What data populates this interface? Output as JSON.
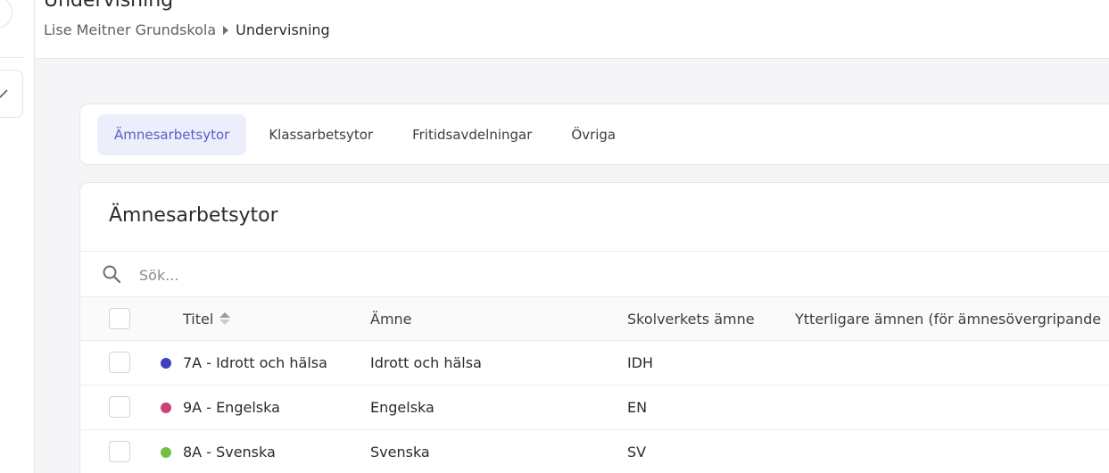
{
  "header": {
    "title": "Undervisning",
    "breadcrumb": {
      "parent": "Lise Meitner Grundskola",
      "current": "Undervisning"
    }
  },
  "tabs": [
    {
      "label": "Ämnesarbetsytor",
      "active": true
    },
    {
      "label": "Klassarbetsytor",
      "active": false
    },
    {
      "label": "Fritidsavdelningar",
      "active": false
    },
    {
      "label": "Övriga",
      "active": false
    }
  ],
  "list": {
    "title": "Ämnesarbetsytor",
    "search": {
      "placeholder": "Sök...",
      "value": ""
    },
    "columns": {
      "title": "Titel",
      "subject": "Ämne",
      "skolverket": "Skolverkets ämne",
      "extra": "Ytterligare ämnen (för ämnesövergripande"
    },
    "rows": [
      {
        "title": "7A - Idrott och hälsa",
        "subject": "Idrott och hälsa",
        "skolverket": "IDH",
        "color": "#3f3fbf"
      },
      {
        "title": "9A - Engelska",
        "subject": "Engelska",
        "skolverket": "EN",
        "color": "#c9437a"
      },
      {
        "title": "8A - Svenska",
        "subject": "Svenska",
        "skolverket": "SV",
        "color": "#74c043"
      }
    ]
  },
  "colors": {
    "accent": "#5a5fc7",
    "active_tab_bg": "#eceefb"
  }
}
